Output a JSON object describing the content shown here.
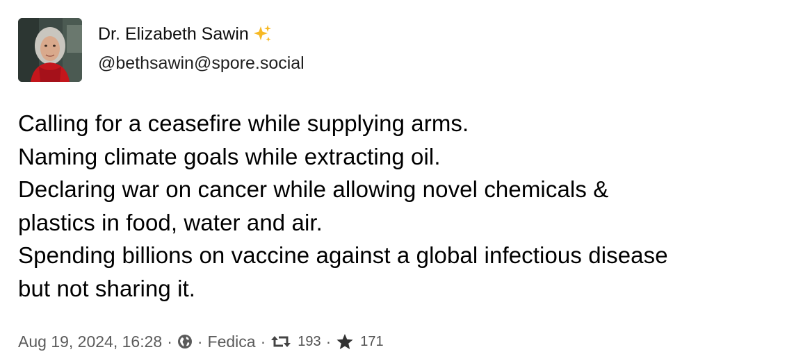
{
  "author": {
    "display_name": "Dr. Elizabeth Sawin",
    "handle": "@bethsawin@spore.social",
    "emoji_icon": "sparkles-icon"
  },
  "post": {
    "lines": [
      "Calling for a ceasefire while supplying arms.",
      "Naming climate goals while extracting oil.",
      "Declaring war on cancer while allowing novel chemicals &",
      "plastics in food, water and air.",
      "Spending billions on vaccine against a global infectious disease",
      "but not sharing it."
    ]
  },
  "meta": {
    "timestamp": "Aug 19, 2024, 16:28",
    "separator": "·",
    "visibility_icon": "globe-icon",
    "application": "Fedica",
    "boost_icon": "retweet-icon",
    "boosts": "193",
    "favourite_icon": "star-icon",
    "favourites": "171"
  },
  "colors": {
    "text": "#000000",
    "meta_text": "#5b5b5b",
    "sparkle": "#f7b924",
    "scarf": "#c4161c"
  }
}
